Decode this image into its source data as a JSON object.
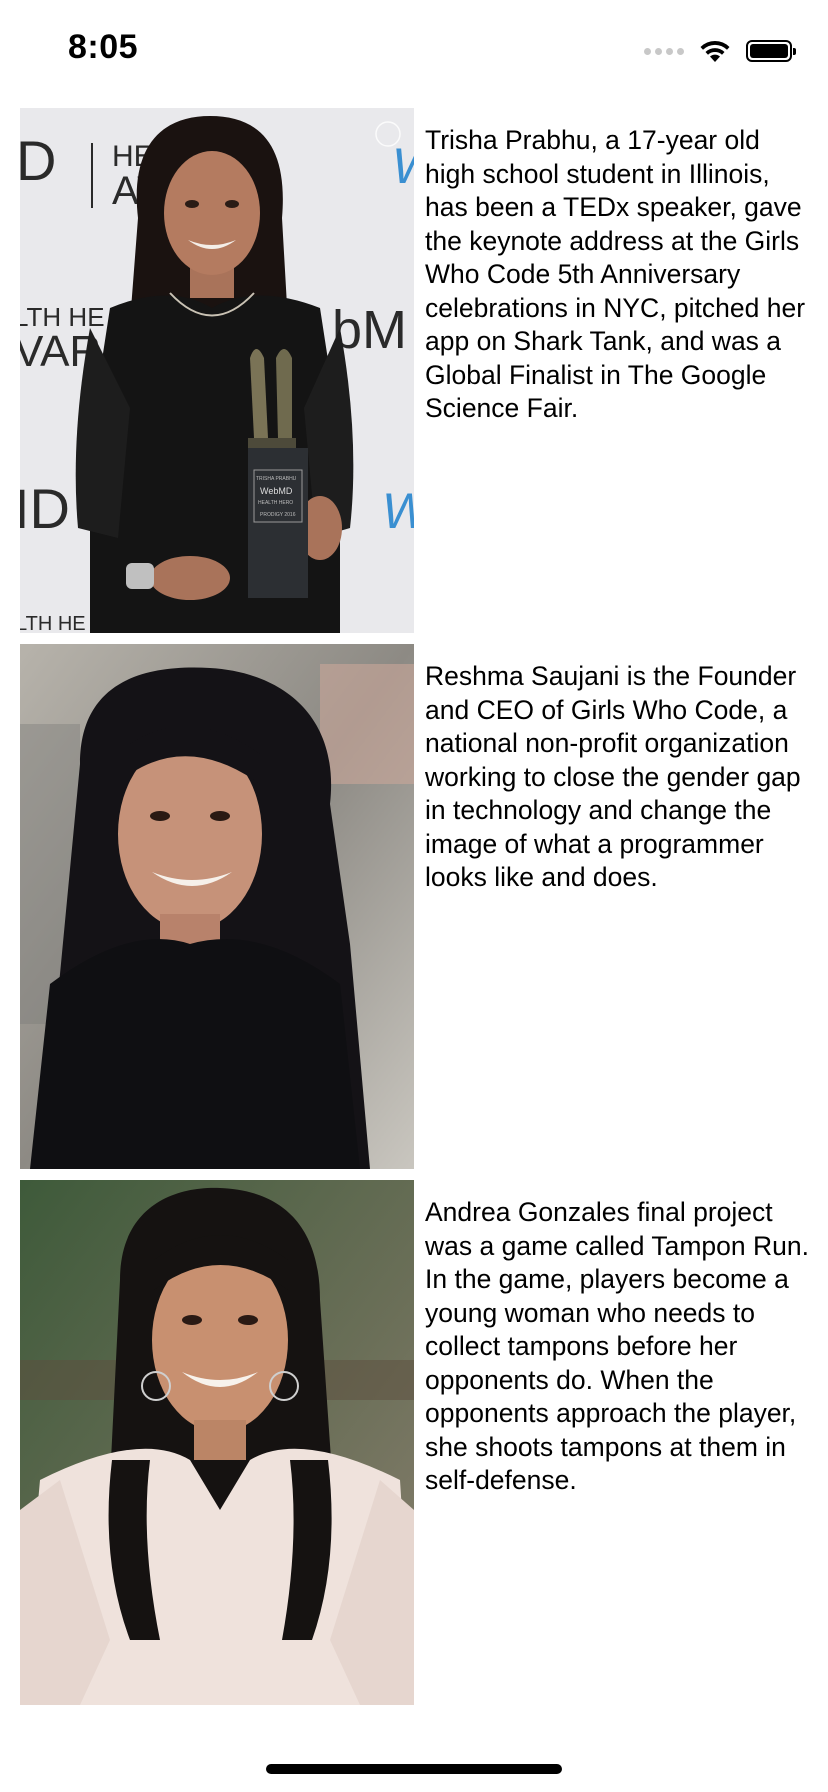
{
  "status_bar": {
    "time": "8:05",
    "icons": [
      "signal-icon",
      "wifi-icon",
      "battery-icon"
    ]
  },
  "people": [
    {
      "photo_icon": "portrait-photo",
      "photo_text": {
        "brand_left": "D",
        "headline": "HEA  RO",
        "awards": "AW  S",
        "side_letter": "W",
        "lower_left": "LTH  HE",
        "vars": "VAR",
        "bm": "bM",
        "id_left": "ID",
        "w2": "W",
        "bottom_text": "LTH  HE",
        "plaque_name": "TRISHA PRABHU",
        "plaque_brand": "WebMD",
        "plaque_line": "HEALTH HERO",
        "plaque_year": "PRODIGY 2016"
      },
      "bio": "Trisha Prabhu, a 17-year old high school student in Illinois, has been a TEDx speaker, gave the keynote address at the Girls Who Code 5th Anniversary celebrations in NYC, pitched her app on Shark Tank, and was a Global Finalist in The Google Science Fair."
    },
    {
      "photo_icon": "portrait-photo",
      "bio": "Reshma Saujani is the Founder and CEO of Girls Who Code, a national non-profit organization working to close the gender gap in technology and change the image of what a programmer looks like and does."
    },
    {
      "photo_icon": "portrait-photo",
      "bio": "Andrea Gonzales final project was a game called Tampon Run. In the game, players become a young woman who needs to collect tampons before her opponents do. When the opponents approach the player, she shoots tampons at them in self-defense."
    }
  ],
  "colors": {
    "background": "#ffffff",
    "text": "#000000",
    "webmd_blue": "#3a8fd1"
  }
}
